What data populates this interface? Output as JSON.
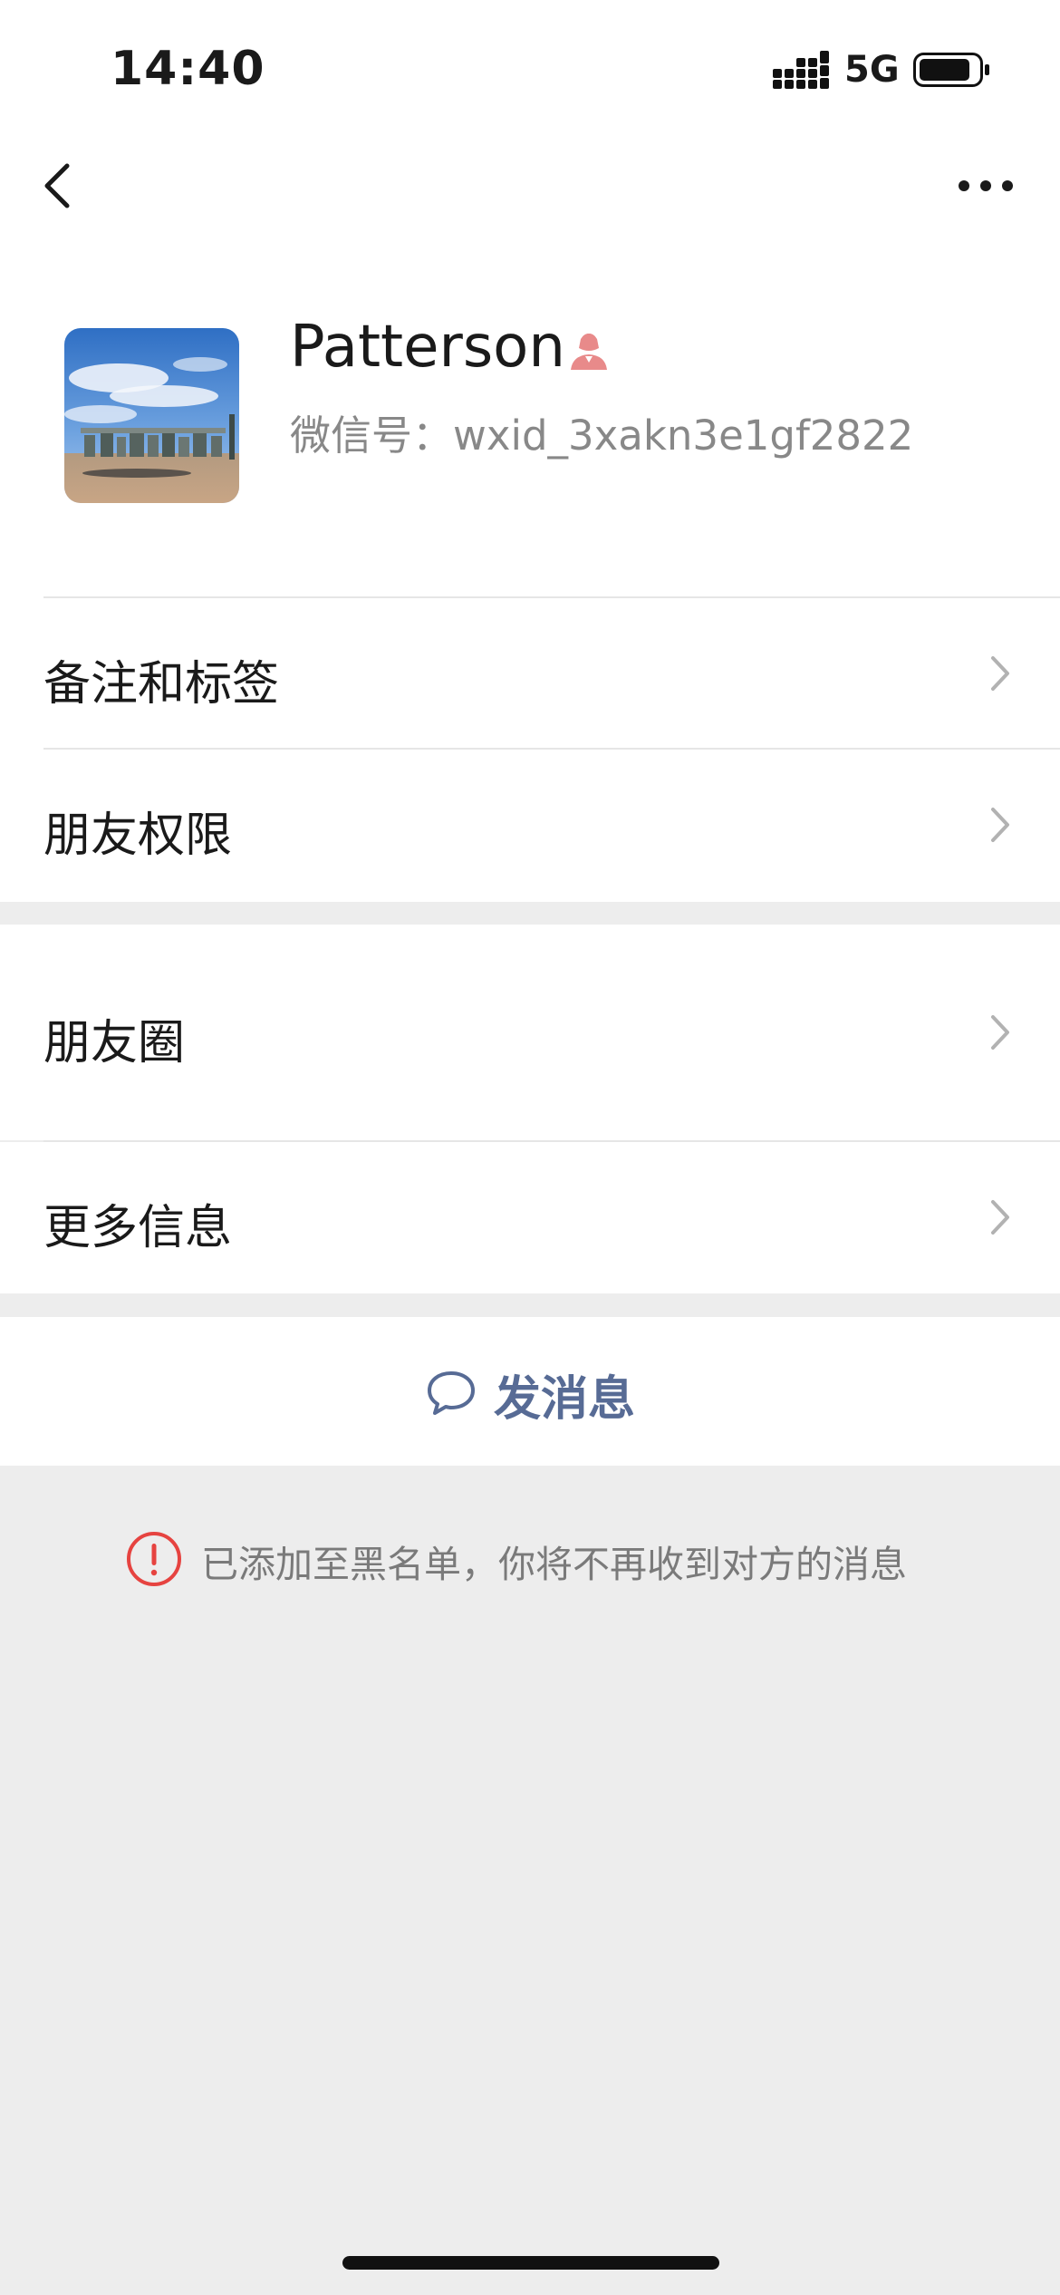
{
  "status_bar": {
    "time": "14:40",
    "network": "5G"
  },
  "nav": {
    "back_icon": "chevron-left-icon",
    "more_icon": "ellipsis-icon"
  },
  "profile": {
    "name": "Patterson",
    "gender_icon": "female-icon",
    "gender_color": "#e88a8a",
    "wechat_id_label": "微信号：",
    "wechat_id": "wxid_3xakn3e1gf2822"
  },
  "section1": {
    "items": [
      {
        "label": "备注和标签"
      },
      {
        "label": "朋友权限"
      }
    ]
  },
  "section2": {
    "items": [
      {
        "label": "朋友圈"
      },
      {
        "label": "更多信息"
      }
    ]
  },
  "actions": {
    "send_message_label": "发消息",
    "send_message_icon": "chat-bubble-icon",
    "accent_color": "#576b95"
  },
  "notice": {
    "icon": "warning-circle-icon",
    "icon_color": "#e64340",
    "text": "已添加至黑名单，你将不再收到对方的消息"
  }
}
